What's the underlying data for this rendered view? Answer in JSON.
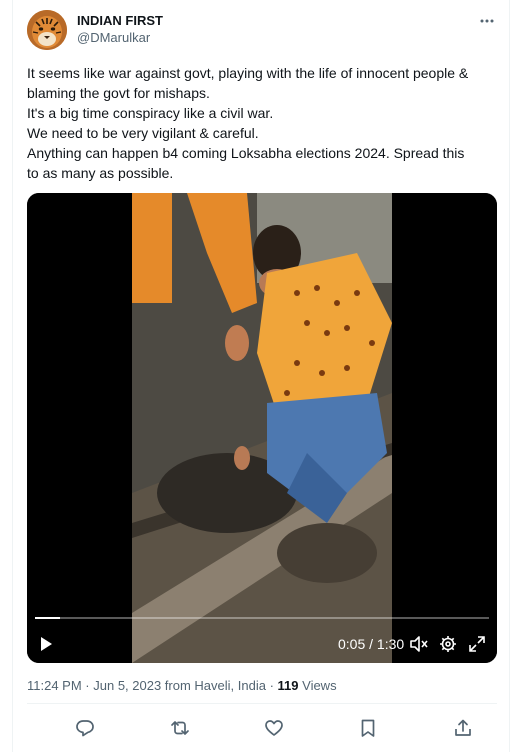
{
  "author": {
    "name": "INDIAN FIRST",
    "handle": "@DMarulkar"
  },
  "tweet": {
    "lines": [
      "It seems like war against govt,  playing with the life of innocent people &",
      "blaming the govt for mishaps.",
      "It's a big time conspiracy like a civil war.",
      "We need to be very vigilant & careful.",
      "Anything can happen b4 coming Loksabha elections 2024. Spread this",
      "to as many as possible."
    ]
  },
  "video": {
    "time_display": "0:05 / 1:30",
    "progress": 0.056
  },
  "meta": {
    "time": "11:24 PM",
    "sep1": " · ",
    "date": "Jun 5, 2023 from Haveli, India",
    "sep2": " · ",
    "views_count": "119",
    "views_label": " Views"
  },
  "icons": {
    "more": "more-horizontal-icon",
    "reply": "reply-icon",
    "retweet": "retweet-icon",
    "like": "heart-icon",
    "bookmark": "bookmark-icon",
    "share": "share-icon"
  },
  "colors": {
    "text_primary": "#0f1419",
    "text_secondary": "#536471",
    "border": "#eff3f4",
    "video_bg": "#000000"
  }
}
